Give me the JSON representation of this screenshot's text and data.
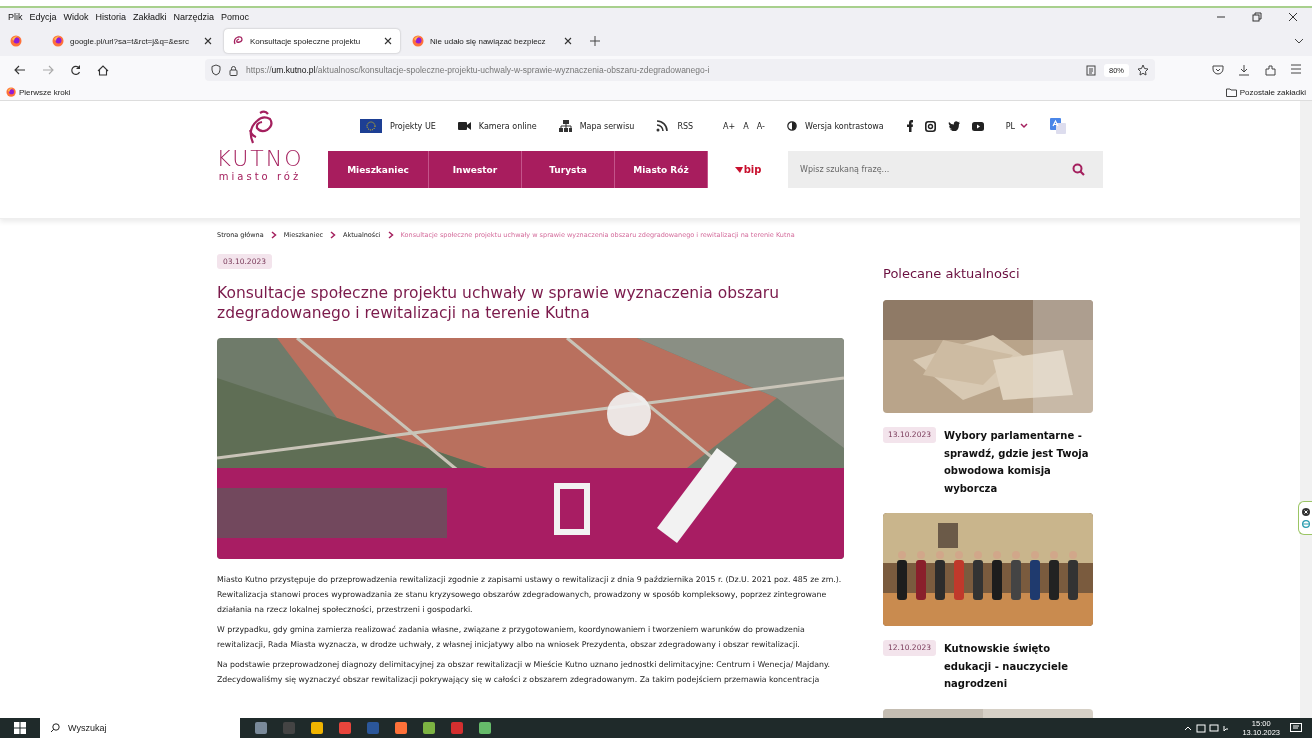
{
  "window": {
    "menu": [
      "Plik",
      "Edycja",
      "Widok",
      "Historia",
      "Zakładki",
      "Narzędzia",
      "Pomoc"
    ],
    "tabs": [
      {
        "title": "google.pl/url?sa=t&rct=j&q=&esrc",
        "selected": false
      },
      {
        "title": "Konsultacje społeczne projektu",
        "selected": true
      },
      {
        "title": "Nie udało się nawiązać bezpiecz",
        "selected": false
      }
    ],
    "url": {
      "scheme": "https://",
      "host": "um.kutno.pl",
      "path": "/aktualnosc/konsultacje-spoleczne-projektu-uchwaly-w-sprawie-wyznaczenia-obszaru-zdegradowanego-i"
    },
    "zoom": "80%",
    "bookmarks": [
      "Pierwsze kroki"
    ],
    "other_bookmarks": "Pozostałe zakładki"
  },
  "site": {
    "logo": {
      "name": "KUTNO",
      "tagline": "miasto róż"
    },
    "top_links": [
      "Projekty UE",
      "Kamera online",
      "Mapa serwisu",
      "RSS"
    ],
    "font_sizes": [
      "A+",
      "A",
      "A-"
    ],
    "contrast": "Wersja kontrastowa",
    "language": "PL",
    "nav": [
      "Mieszkaniec",
      "Inwestor",
      "Turysta",
      "Miasto Róż"
    ],
    "bip": "bip",
    "search": {
      "placeholder": "Wpisz szukaną frazę..."
    },
    "breadcrumb": [
      {
        "label": "Strona główna",
        "current": false
      },
      {
        "label": "Mieszkaniec",
        "current": false
      },
      {
        "label": "Aktualności",
        "current": false
      },
      {
        "label": "Konsultacje społeczne projektu uchwały w sprawie wyznaczenia obszaru zdegradowanego i rewitalizacji na terenie Kutna",
        "current": true
      }
    ],
    "article": {
      "date": "03.10.2023",
      "title": "Konsultacje społeczne projektu uchwały w sprawie wyznaczenia obszaru zdegradowanego i rewitalizacji na terenie Kutna",
      "image": {
        "kind": "picture"
      },
      "paragraphs": [
        "Miasto Kutno przystępuje do przeprowadzenia rewitalizacji zgodnie z zapisami ustawy o rewitalizacji z dnia 9 października 2015 r. (Dz.U. 2021 poz. 485 ze zm.). Rewitalizacja stanowi proces wyprowadzania ze stanu kryzysowego obszarów zdegradowanych, prowadzony w sposób kompleksowy, poprzez zintegrowane działania na rzecz lokalnej społeczności, przestrzeni i gospodarki.",
        "W przypadku, gdy gmina zamierza realizować zadania własne, związane z przygotowaniem, koordynowaniem i tworzeniem warunków do prowadzenia rewitalizacji, Rada Miasta wyznacza, w drodze uchwały, z własnej inicjatywy albo na wniosek Prezydenta, obszar zdegradowany i obszar rewitalizacji.",
        "Na podstawie przeprowadzonej diagnozy delimitacyjnej za obszar rewitalizacji w Mieście Kutno uznano jednostki delimitacyjne: Centrum i Wenecja/ Majdany. Zdecydowaliśmy się wyznaczyć obszar rewitalizacji pokrywający się w całości z obszarem zdegradowanym. Za takim podejściem przemawia koncentracja"
      ]
    },
    "sidebar": {
      "heading": "Polecane aktualności",
      "news": [
        {
          "date": "13.10.2023",
          "title": "Wybory parlamentarne - sprawdź, gdzie jest Twoja obwodowa komisja wyborcza",
          "image": {
            "kind": "picture"
          }
        },
        {
          "date": "12.10.2023",
          "title": "Kutnowskie święto edukacji - nauczyciele nagrodzeni",
          "image": {
            "kind": "picture"
          }
        },
        {
          "image": {
            "kind": "picture"
          }
        }
      ]
    }
  },
  "taskbar": {
    "search": "Wyszukaj",
    "time": "15:00",
    "date": "13.10.2023"
  }
}
